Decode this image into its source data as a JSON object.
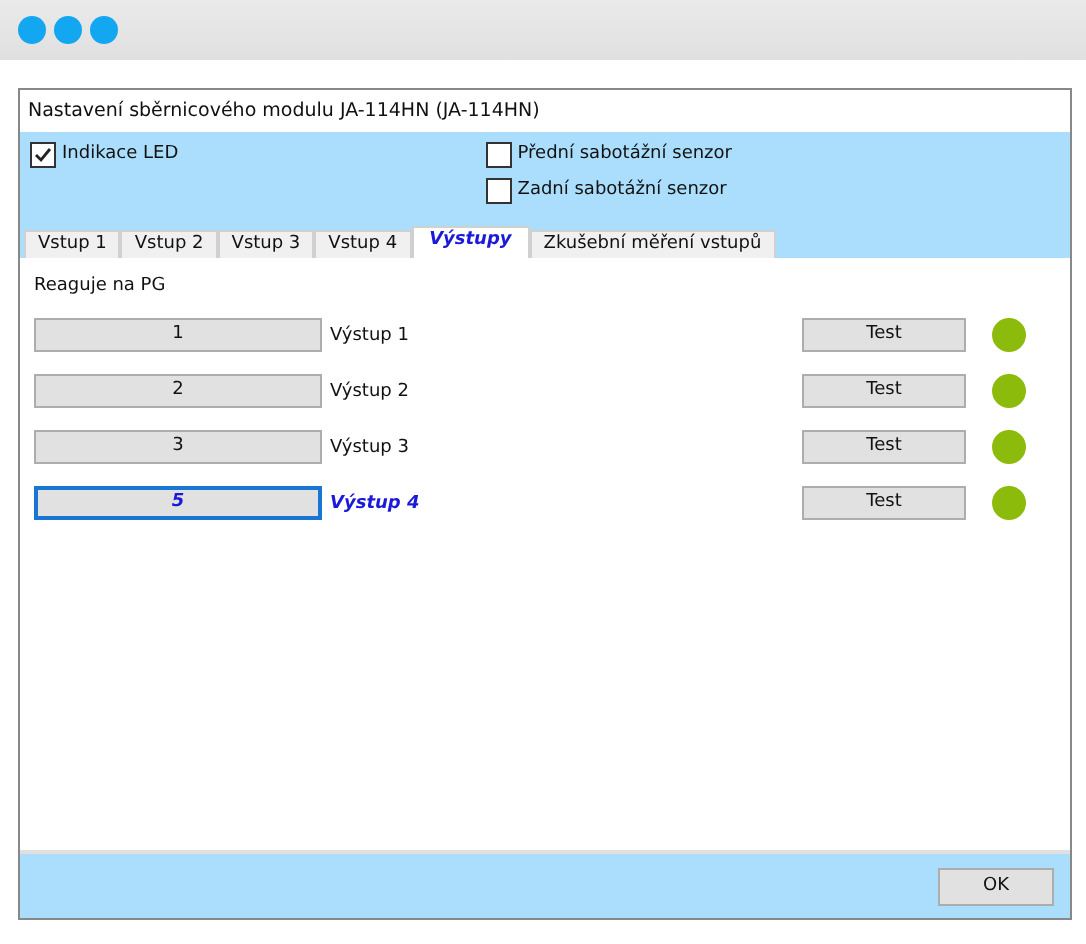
{
  "dialog": {
    "title": "Nastavení sběrnicového modulu JA-114HN (JA-114HN)"
  },
  "options": [
    {
      "label": "Indikace LED",
      "checked": true
    },
    {
      "label": "Přední sabotážní senzor",
      "checked": false
    },
    {
      "label": "Zadní sabotážní senzor",
      "checked": false
    }
  ],
  "tabs": [
    {
      "label": "Vstup 1",
      "selected": false
    },
    {
      "label": "Vstup 2",
      "selected": false
    },
    {
      "label": "Vstup 3",
      "selected": false
    },
    {
      "label": "Vstup 4",
      "selected": false
    },
    {
      "label": "Výstupy",
      "selected": true
    },
    {
      "label": "Zkušební měření vstupů",
      "selected": false
    }
  ],
  "section_label": "Reaguje na PG",
  "outputs": [
    {
      "value": "1",
      "name": "Výstup 1",
      "focused": false,
      "test": "Test",
      "on": true
    },
    {
      "value": "2",
      "name": "Výstup 2",
      "focused": false,
      "test": "Test",
      "on": true
    },
    {
      "value": "3",
      "name": "Výstup 3",
      "focused": false,
      "test": "Test",
      "on": true
    },
    {
      "value": "5",
      "name": "Výstup 4",
      "focused": true,
      "test": "Test",
      "on": true
    }
  ],
  "ok_button": "OK"
}
